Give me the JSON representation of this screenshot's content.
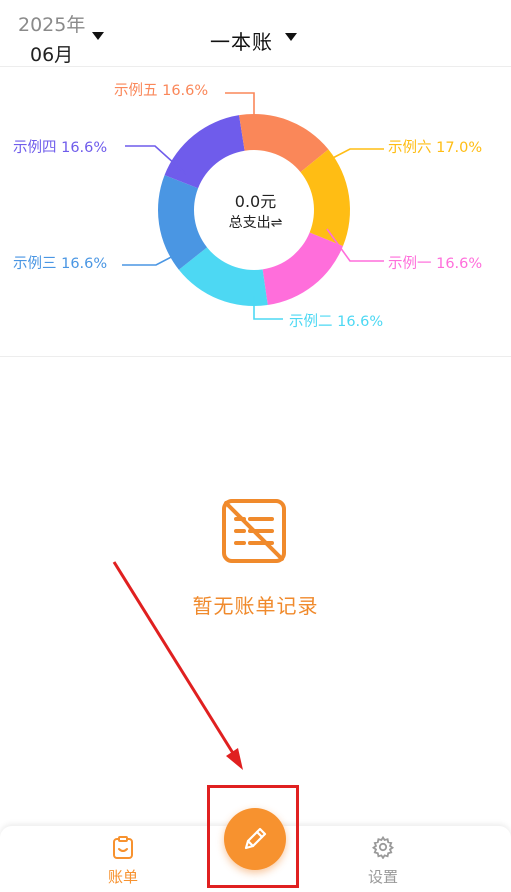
{
  "header": {
    "year": "2025年",
    "month": "06月",
    "book_title": "一本账"
  },
  "chart_data": {
    "type": "pie",
    "center_value": "0.0元",
    "center_label": "总支出⇌",
    "slices": [
      {
        "label": "示例一 16.6%",
        "name": "示例一",
        "percent": 16.6,
        "color": "#ff6edb"
      },
      {
        "label": "示例二 16.6%",
        "name": "示例二",
        "percent": 16.6,
        "color": "#4dd8f3"
      },
      {
        "label": "示例三 16.6%",
        "name": "示例三",
        "percent": 16.6,
        "color": "#4a96e3"
      },
      {
        "label": "示例四 16.6%",
        "name": "示例四",
        "percent": 16.6,
        "color": "#6f5ceb"
      },
      {
        "label": "示例五 16.6%",
        "name": "示例五",
        "percent": 16.6,
        "color": "#fa8759"
      },
      {
        "label": "示例六 17.0%",
        "name": "示例六",
        "percent": 17.0,
        "color": "#ffbd14"
      }
    ]
  },
  "empty_state": {
    "icon": "no-bill-icon",
    "text": "暂无账单记录"
  },
  "bottom_nav": {
    "items": [
      {
        "label": "账单",
        "icon": "clipboard-icon",
        "active": true
      },
      {
        "label": "设置",
        "icon": "gear-icon",
        "active": false
      }
    ],
    "fab_icon": "pencil-icon"
  },
  "colors": {
    "accent": "#f7922f",
    "annotation": "#e02020",
    "inactive": "#9a9a9a"
  }
}
